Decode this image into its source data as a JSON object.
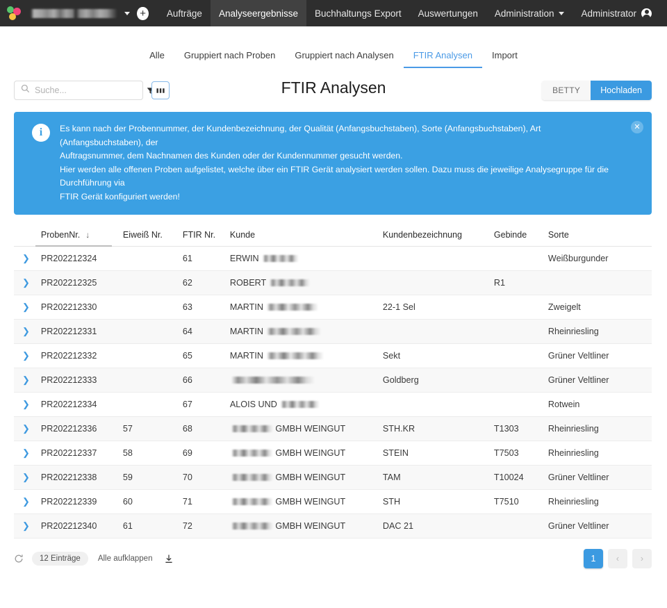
{
  "topnav": {
    "logo_name": "app-logo",
    "org_name_redacted": "",
    "add_label": "+",
    "links": [
      {
        "label": "Aufträge",
        "active": false
      },
      {
        "label": "Analyseergebnisse",
        "active": true
      },
      {
        "label": "Buchhaltungs Export",
        "active": false
      },
      {
        "label": "Auswertungen",
        "active": false
      }
    ],
    "admin_menu": "Administration",
    "user_label": "Administrator"
  },
  "subtabs": [
    {
      "label": "Alle",
      "active": false
    },
    {
      "label": "Gruppiert nach Proben",
      "active": false
    },
    {
      "label": "Gruppiert nach Analysen",
      "active": false
    },
    {
      "label": "FTIR Analysen",
      "active": true
    },
    {
      "label": "Import",
      "active": false
    }
  ],
  "toolbar": {
    "search_placeholder": "Suche...",
    "search_value": "",
    "filter_icon": "funnel-icon",
    "columns_icon": "columns-icon",
    "title": "FTIR Analysen",
    "betty_label": "BETTY",
    "upload_label": "Hochladen"
  },
  "banner": {
    "icon": "info-icon",
    "line1": "Es kann nach der Probennummer, der Kundenbezeichnung, der Qualität (Anfangsbuchstaben), Sorte (Anfangsbuchstaben), Art (Anfangsbuchstaben), der",
    "line2": "Auftragsnummer, dem Nachnamen des Kunden oder der Kundennummer gesucht werden.",
    "line3": "Hier werden alle offenen Proben aufgelistet, welche über ein FTIR Gerät analysiert werden sollen. Dazu muss die jeweilige Analysegruppe für die Durchführung via",
    "line4": "FTIR Gerät konfiguriert werden!",
    "close_label": "✕"
  },
  "table": {
    "columns": [
      {
        "key": "expand",
        "label": ""
      },
      {
        "key": "probennr",
        "label": "ProbenNr.",
        "sorted": true,
        "sort_dir": "↓"
      },
      {
        "key": "eiweiss",
        "label": "Eiweiß Nr."
      },
      {
        "key": "ftir",
        "label": "FTIR Nr."
      },
      {
        "key": "kunde",
        "label": "Kunde"
      },
      {
        "key": "kundenbez",
        "label": "Kundenbezeichnung"
      },
      {
        "key": "gebinde",
        "label": "Gebinde"
      },
      {
        "key": "sorte",
        "label": "Sorte"
      }
    ],
    "rows": [
      {
        "probennr": "PR202212324",
        "eiweiss": "",
        "ftir": "61",
        "kunde_prefix": "ERWIN",
        "kunde_redact_w": 52,
        "kunde_suffix": "",
        "kundenbez": "",
        "gebinde": "",
        "sorte": "Weißburgunder"
      },
      {
        "probennr": "PR202212325",
        "eiweiss": "",
        "ftir": "62",
        "kunde_prefix": "ROBERT",
        "kunde_redact_w": 58,
        "kunde_suffix": "",
        "kundenbez": "",
        "gebinde": "R1",
        "sorte": ""
      },
      {
        "probennr": "PR202212330",
        "eiweiss": "",
        "ftir": "63",
        "kunde_prefix": "MARTIN",
        "kunde_redact_w": 74,
        "kunde_suffix": "",
        "kundenbez": "22-1 Sel",
        "gebinde": "",
        "sorte": "Zweigelt"
      },
      {
        "probennr": "PR202212331",
        "eiweiss": "",
        "ftir": "64",
        "kunde_prefix": "MARTIN",
        "kunde_redact_w": 78,
        "kunde_suffix": "",
        "kundenbez": "",
        "gebinde": "",
        "sorte": "Rheinriesling"
      },
      {
        "probennr": "PR202212332",
        "eiweiss": "",
        "ftir": "65",
        "kunde_prefix": "MARTIN",
        "kunde_redact_w": 82,
        "kunde_suffix": "",
        "kundenbez": "Sekt",
        "gebinde": "",
        "sorte": "Grüner Veltliner"
      },
      {
        "probennr": "PR202212333",
        "eiweiss": "",
        "ftir": "66",
        "kunde_prefix": "",
        "kunde_redact_w": 120,
        "kunde_suffix": "",
        "kundenbez": "Goldberg",
        "gebinde": "",
        "sorte": "Grüner Veltliner"
      },
      {
        "probennr": "PR202212334",
        "eiweiss": "",
        "ftir": "67",
        "kunde_prefix": "ALOIS UND",
        "kunde_redact_w": 56,
        "kunde_suffix": "",
        "kundenbez": "",
        "gebinde": "",
        "sorte": "Rotwein"
      },
      {
        "probennr": "PR202212336",
        "eiweiss": "57",
        "ftir": "68",
        "kunde_prefix": "",
        "kunde_redact_w": 60,
        "kunde_suffix": "GMBH WEINGUT",
        "kundenbez": "STH.KR",
        "gebinde": "T1303",
        "sorte": "Rheinriesling"
      },
      {
        "probennr": "PR202212337",
        "eiweiss": "58",
        "ftir": "69",
        "kunde_prefix": "",
        "kunde_redact_w": 60,
        "kunde_suffix": "GMBH WEINGUT",
        "kundenbez": "STEIN",
        "gebinde": "T7503",
        "sorte": "Rheinriesling"
      },
      {
        "probennr": "PR202212338",
        "eiweiss": "59",
        "ftir": "70",
        "kunde_prefix": "",
        "kunde_redact_w": 60,
        "kunde_suffix": "GMBH WEINGUT",
        "kundenbez": "TAM",
        "gebinde": "T10024",
        "sorte": "Grüner Veltliner"
      },
      {
        "probennr": "PR202212339",
        "eiweiss": "60",
        "ftir": "71",
        "kunde_prefix": "",
        "kunde_redact_w": 60,
        "kunde_suffix": "GMBH WEINGUT",
        "kundenbez": "STH",
        "gebinde": "T7510",
        "sorte": "Rheinriesling"
      },
      {
        "probennr": "PR202212340",
        "eiweiss": "61",
        "ftir": "72",
        "kunde_prefix": "",
        "kunde_redact_w": 60,
        "kunde_suffix": "GMBH WEINGUT",
        "kundenbez": "DAC 21",
        "gebinde": "",
        "sorte": "Grüner Veltliner"
      }
    ]
  },
  "footer": {
    "refresh_icon": "refresh-icon",
    "count_label": "12 Einträge",
    "expand_all_label": "Alle aufklappen",
    "download_icon": "download-icon",
    "pager": {
      "current_page": "1",
      "prev_label": "‹",
      "next_label": "›"
    }
  },
  "colors": {
    "accent": "#3b9ae1",
    "banner": "#3ba0e3",
    "topnav": "#2e2e2e",
    "tab_active": "#4a9ae6"
  }
}
